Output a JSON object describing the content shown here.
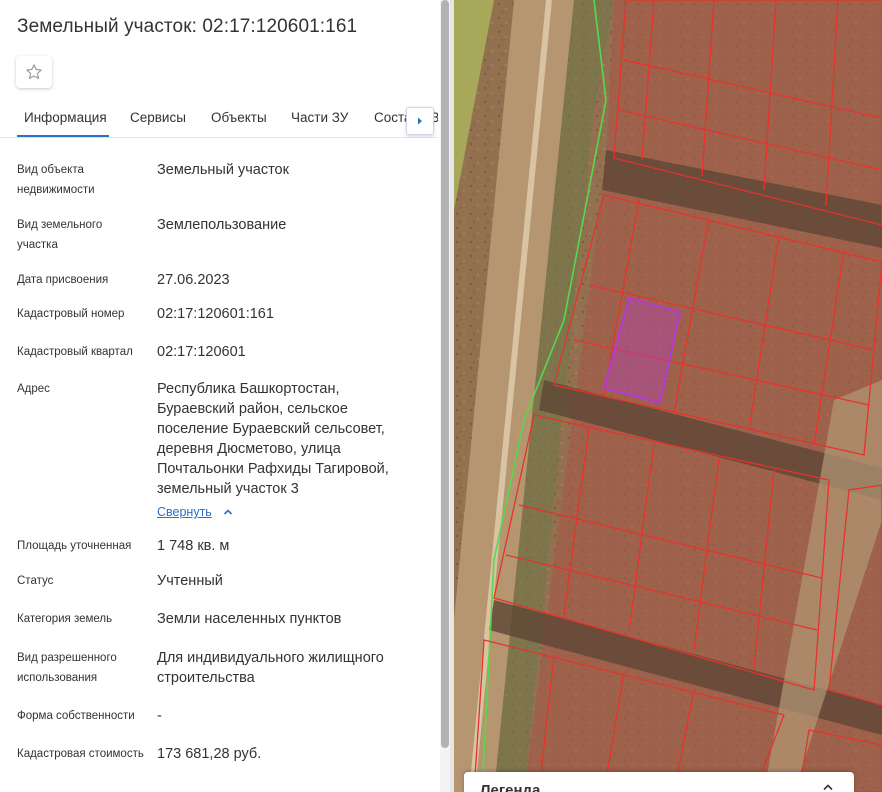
{
  "header": {
    "title": "Земельный участок: 02:17:120601:161",
    "favorite_icon": "star-outline-icon"
  },
  "tabs": [
    {
      "label": "Информация",
      "active": true
    },
    {
      "label": "Сервисы",
      "active": false
    },
    {
      "label": "Объекты",
      "active": false
    },
    {
      "label": "Части ЗУ",
      "active": false
    },
    {
      "label": "Состав ЕЗП",
      "active": false
    }
  ],
  "tab_scroll_icon": "chevron-right-icon",
  "info": {
    "object_type": {
      "label": "Вид объекта недвижимости",
      "value": "Земельный участок"
    },
    "parcel_type": {
      "label": "Вид земельного участка",
      "value": "Землепользование"
    },
    "assign_date": {
      "label": "Дата присвоения",
      "value": "27.06.2023"
    },
    "cadastral_number": {
      "label": "Кадастровый номер",
      "value": "02:17:120601:161"
    },
    "cadastral_block": {
      "label": "Кадастровый квартал",
      "value": "02:17:120601"
    },
    "address": {
      "label": "Адрес",
      "value": "Республика Башкортостан, Бураевский район, сельское поселение Бураевский сельсовет, деревня Дюсметово, улица Почтальонки Рафхиды Тагировой, земельный участок 3",
      "collapse_label": "Свернуть"
    },
    "area": {
      "label": "Площадь уточненная",
      "value": "1 748 кв. м"
    },
    "status": {
      "label": "Статус",
      "value": "Учтенный"
    },
    "land_category": {
      "label": "Категория земель",
      "value": "Земли населенных пунктов"
    },
    "permitted_use": {
      "label": "Вид разрешенного использования",
      "value": "Для индивидуального жилищного строительства"
    },
    "ownership_form": {
      "label": "Форма собственности",
      "value": "-"
    },
    "cadastral_value": {
      "label": "Кадастровая стоимость",
      "value": "173 681,28 руб."
    }
  },
  "legend": {
    "title": "Легенда",
    "toggle_icon": "chevron-up-icon"
  },
  "colors": {
    "accent": "#2d6fc4",
    "parcel_border": "#e8322b",
    "selected_parcel": "#b43cc8",
    "boundary_line": "#59d84a"
  }
}
